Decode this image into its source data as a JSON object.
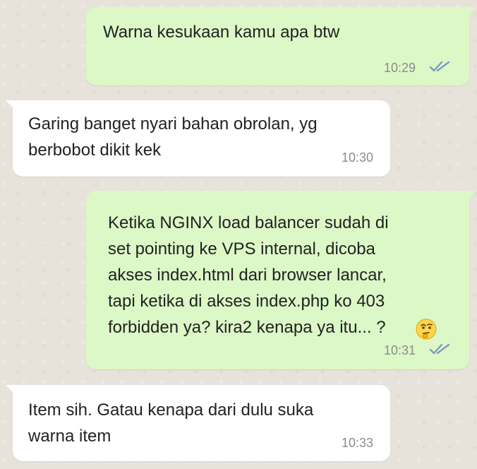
{
  "messages": [
    {
      "direction": "outgoing",
      "text": "Warna kesukaan kamu apa btw",
      "time": "10:29",
      "status_icon": "double-check-icon",
      "bubble_color": "#dcf8c6"
    },
    {
      "direction": "incoming",
      "text": "Garing banget nyari bahan obrolan, yg\nberbobot dikit kek",
      "time": "10:30",
      "bubble_color": "#ffffff"
    },
    {
      "direction": "outgoing",
      "text": "Ketika NGINX load balancer sudah di\nset pointing ke VPS internal, dicoba\nakses index.html dari browser lancar,\ntapi ketika di akses index.php ko 403\nforbidden ya? kira2 kenapa ya itu... ?",
      "emoji": "thinking-face-emoji",
      "time": "10:31",
      "status_icon": "double-check-icon",
      "bubble_color": "#dcf8c6"
    },
    {
      "direction": "incoming",
      "text": "Item sih. Gatau kenapa dari dulu suka\nwarna item",
      "time": "10:33",
      "bubble_color": "#ffffff"
    }
  ],
  "colors": {
    "background": "#e7e2da",
    "time_text": "#8b8b8b",
    "check_icon": "#7f9ac0"
  }
}
